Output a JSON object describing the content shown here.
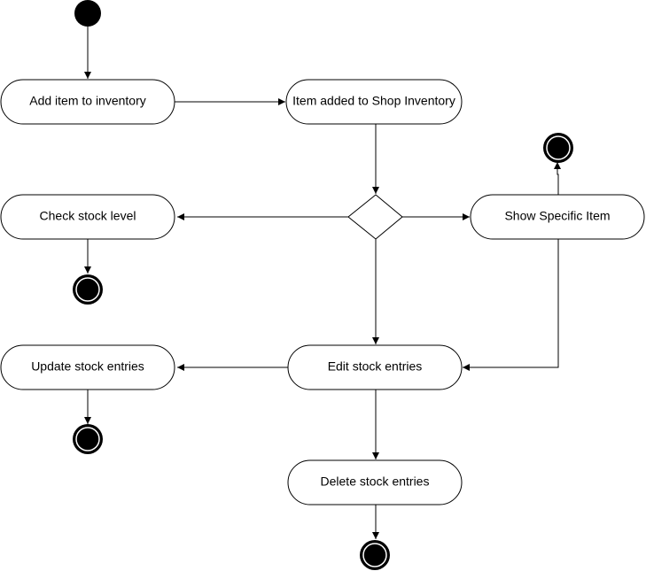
{
  "activities": {
    "add_item": "Add item to inventory",
    "item_added": "Item added to Shop Inventory",
    "check_stock": "Check stock level",
    "show_item": "Show Specific Item",
    "update_stock": "Update stock entries",
    "edit_stock": "Edit stock entries",
    "delete_stock": "Delete stock entries"
  },
  "colors": {
    "line": "#000000",
    "fill": "#ffffff",
    "node": "#000000"
  }
}
